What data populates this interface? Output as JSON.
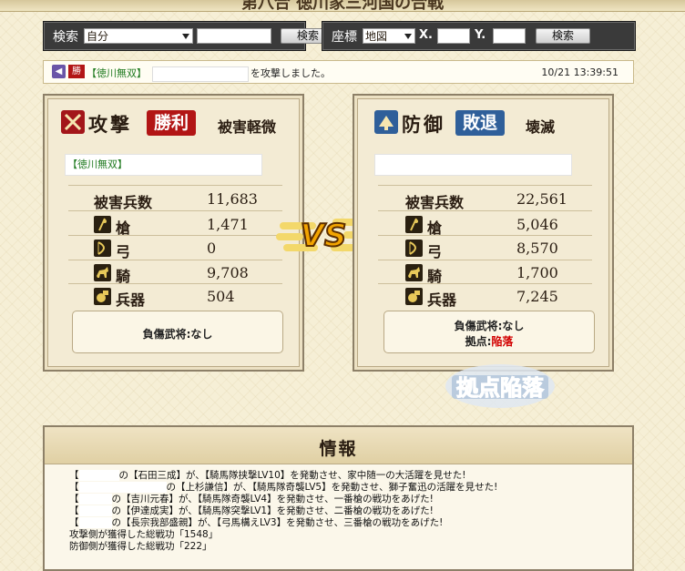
{
  "title": "第八合 徳川家三河国の合戦",
  "search_bar": {
    "label": "検索",
    "select": "自分",
    "button": "検索"
  },
  "coord_bar": {
    "label": "座標",
    "select": "地図",
    "x_label": "X.",
    "y_label": "Y.",
    "button": "検索"
  },
  "log": {
    "badge": "勝",
    "alliance": "【徳川無双】",
    "message": "を攻撃しました。",
    "timestamp": "10/21 13:39:51"
  },
  "attacker": {
    "role": "攻撃",
    "badge": "勝利",
    "result": "被害軽微",
    "alliance": "【徳川無双】",
    "casualties_label": "被害兵数",
    "casualties": "11,683",
    "units": [
      {
        "label": "槍",
        "value": "1,471"
      },
      {
        "label": "弓",
        "value": "0"
      },
      {
        "label": "騎",
        "value": "9,708"
      },
      {
        "label": "兵器",
        "value": "504"
      }
    ],
    "wounded": "負傷武将:なし"
  },
  "defender": {
    "role": "防御",
    "badge": "敗退",
    "result": "壊滅",
    "casualties_label": "被害兵数",
    "casualties": "22,561",
    "units": [
      {
        "label": "槍",
        "value": "5,046"
      },
      {
        "label": "弓",
        "value": "8,570"
      },
      {
        "label": "騎",
        "value": "1,700"
      },
      {
        "label": "兵器",
        "value": "7,245"
      }
    ],
    "wounded": "負傷武将:なし",
    "base_label": "拠点:",
    "base_value": "陥落"
  },
  "vs_text": "VS",
  "fallen_stamp": "拠点陥落",
  "info": {
    "title": "情報",
    "lines": [
      {
        "pre": "【",
        "post": "の【石田三成】が、【騎馬隊挟撃LV10】を発動させ、家中随一の大活躍を見せた!"
      },
      {
        "pre": "【",
        "post": "の【上杉謙信】が、【騎馬隊奇襲LV5】を発動させ、獅子奮迅の活躍を見せた!"
      },
      {
        "pre": "【",
        "post": "の【吉川元春】が、【騎馬隊奇襲LV4】を発動させ、一番槍の戦功をあげた!"
      },
      {
        "pre": "【",
        "post": "の【伊達成実】が、【騎馬隊突撃LV1】を発動させ、二番槍の戦功をあげた!"
      },
      {
        "pre": "【",
        "post": "の【長宗我部盛親】が、【弓馬構えLV3】を発動させ、三番槍の戦功をあげた!"
      }
    ],
    "attack_merit": "攻撃側が獲得した総戦功「1548」",
    "defense_merit": "防御側が獲得した総戦功「222」"
  },
  "colors": {
    "win_red": "#b21515",
    "lose_blue": "#2f5f9a",
    "alliance_green": "#1f7a1f",
    "fallen_red": "#d20000"
  }
}
